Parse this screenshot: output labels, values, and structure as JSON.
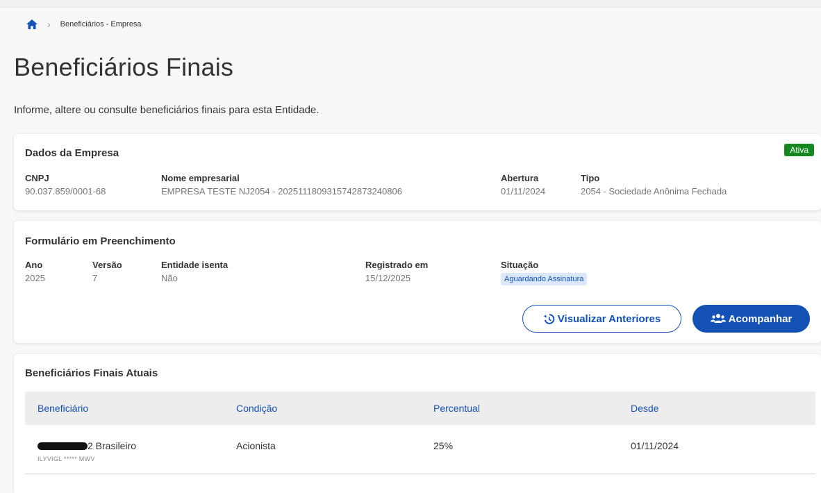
{
  "breadcrumb": {
    "home_icon": "home-icon",
    "separator_icon": "chevron-right-icon",
    "current": "Beneficiários - Empresa"
  },
  "page": {
    "title": "Beneficiários Finais",
    "subtitle": "Informe, altere ou consulte beneficiários finais para esta Entidade."
  },
  "empresa": {
    "title": "Dados da Empresa",
    "status": "Ativa",
    "status_color": "#168821",
    "cnpj_label": "CNPJ",
    "cnpj": "90.037.859/0001-68",
    "nome_label": "Nome empresarial",
    "nome": "EMPRESA TESTE NJ2054 - 20251118093157428732408​06",
    "abertura_label": "Abertura",
    "abertura": "01/11/2024",
    "tipo_label": "Tipo",
    "tipo": "2054 - Sociedade Anônima Fechada"
  },
  "formulario": {
    "title": "Formulário em Preenchimento",
    "ano_label": "Ano",
    "ano": "2025",
    "versao_label": "Versão",
    "versao": "7",
    "isenta_label": "Entidade isenta",
    "isenta": "Não",
    "registrado_label": "Registrado em",
    "registrado": "15/12/2025",
    "situacao_label": "Situação",
    "situacao": "Aguardando Assinatura",
    "btn_anteriores": "Visualizar Anteriores",
    "btn_anteriores_icon": "history-icon",
    "btn_acompanhar": "Acompanhar",
    "btn_acompanhar_icon": "users-icon",
    "accent": "#1351b4"
  },
  "beneficiarios": {
    "title": "Beneficiários Finais Atuais",
    "columns": [
      "Beneficiário",
      "Condição",
      "Percentual",
      "Desde"
    ],
    "rows": [
      {
        "beneficiario_suffix": "2 Brasileiro",
        "beneficiario_sub": "ILYVIGL ***** MWV",
        "condicao": "Acionista",
        "percentual": "25%",
        "desde": "01/11/2024"
      }
    ]
  }
}
